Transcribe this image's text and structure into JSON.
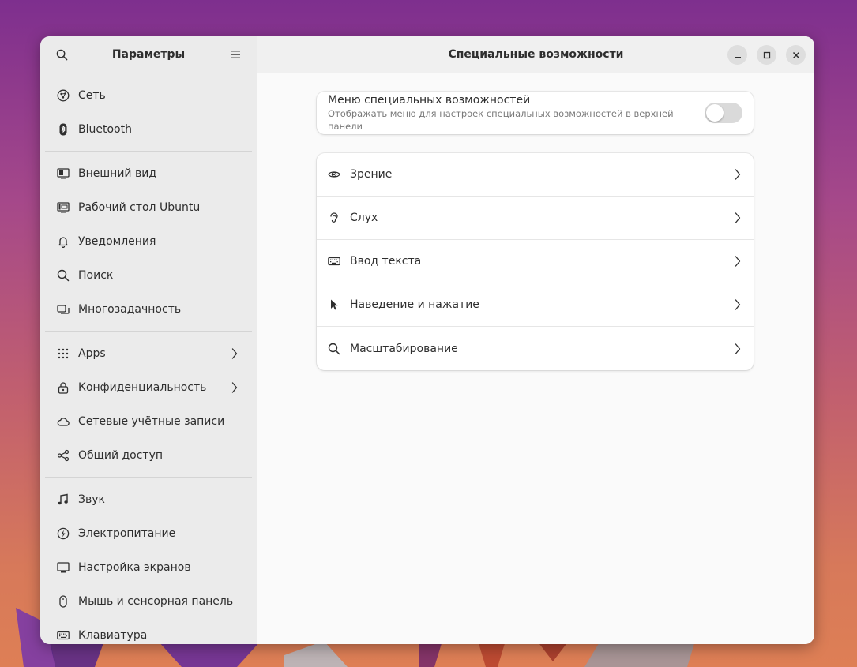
{
  "sidebar": {
    "title": "Параметры",
    "groups": [
      [
        {
          "label": "Сеть",
          "icon": "network-icon"
        },
        {
          "label": "Bluetooth",
          "icon": "bluetooth-icon"
        }
      ],
      [
        {
          "label": "Внешний вид",
          "icon": "appearance-icon"
        },
        {
          "label": "Рабочий стол Ubuntu",
          "icon": "desktop-icon"
        },
        {
          "label": "Уведомления",
          "icon": "bell-icon"
        },
        {
          "label": "Поиск",
          "icon": "search-icon"
        },
        {
          "label": "Многозадачность",
          "icon": "multitasking-icon"
        }
      ],
      [
        {
          "label": "Apps",
          "icon": "apps-grid-icon",
          "chevron": true
        },
        {
          "label": "Конфиденциальность",
          "icon": "lock-icon",
          "chevron": true
        },
        {
          "label": "Сетевые учётные записи",
          "icon": "cloud-icon"
        },
        {
          "label": "Общий доступ",
          "icon": "share-icon"
        }
      ],
      [
        {
          "label": "Звук",
          "icon": "music-note-icon"
        },
        {
          "label": "Электропитание",
          "icon": "power-icon"
        },
        {
          "label": "Настройка экранов",
          "icon": "monitor-icon"
        },
        {
          "label": "Мышь и сенсорная панель",
          "icon": "mouse-icon"
        },
        {
          "label": "Клавиатура",
          "icon": "keyboard-icon"
        }
      ]
    ]
  },
  "main": {
    "title": "Специальные возможности",
    "toggle": {
      "title": "Меню специальных возможностей",
      "subtitle": "Отображать меню для настроек специальных возможностей в верхней панели",
      "enabled": false
    },
    "rows": [
      {
        "label": "Зрение",
        "icon": "eye-icon"
      },
      {
        "label": "Слух",
        "icon": "ear-icon"
      },
      {
        "label": "Ввод текста",
        "icon": "keyboard-icon"
      },
      {
        "label": "Наведение и нажатие",
        "icon": "pointer-icon"
      },
      {
        "label": "Масштабирование",
        "icon": "zoom-icon"
      }
    ]
  },
  "colors": {
    "text": "#2e2e2e",
    "subtext": "#7a7a7a",
    "sidebar_bg": "#ebebeb",
    "main_bg": "#fafafa"
  }
}
